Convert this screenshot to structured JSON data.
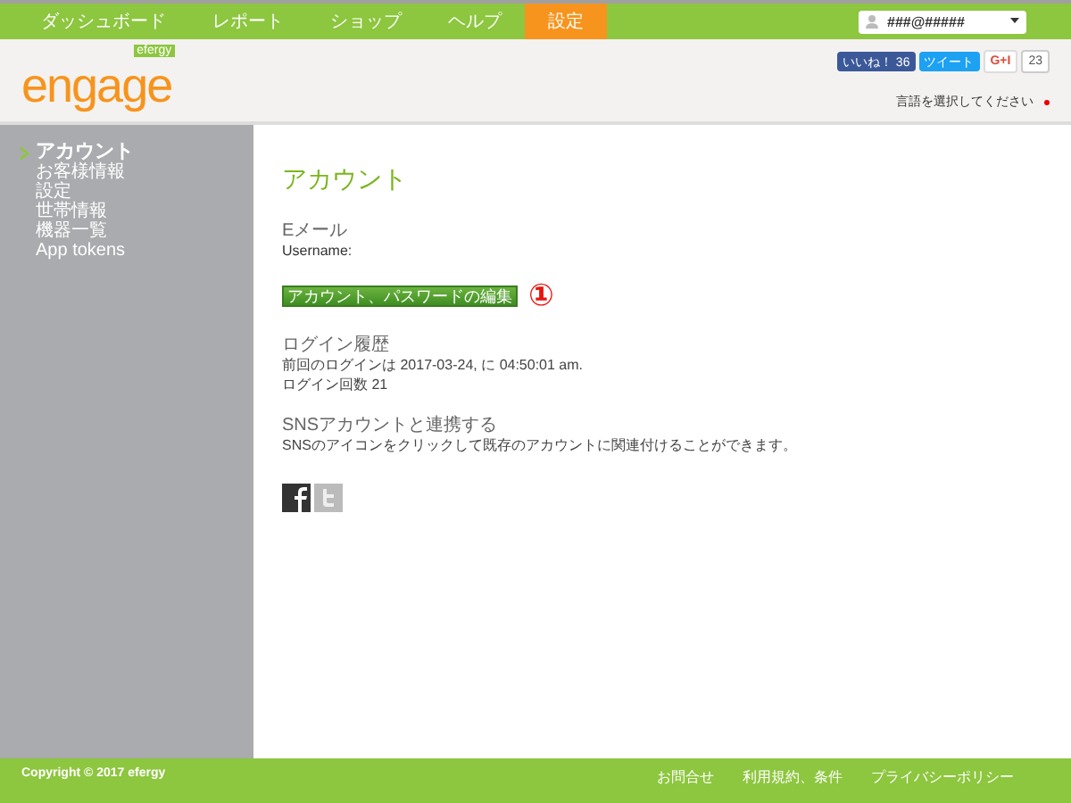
{
  "nav": {
    "tabs": [
      {
        "label": "ダッシュボード",
        "selected": false
      },
      {
        "label": "レポート",
        "selected": false
      },
      {
        "label": "ショップ",
        "selected": false
      },
      {
        "label": "ヘルプ",
        "selected": false
      },
      {
        "label": "設定",
        "selected": true
      }
    ],
    "user": "###@#####"
  },
  "header": {
    "logo": "engage",
    "logo_badge": "efergy",
    "like": {
      "label": "いいね！",
      "count": "36"
    },
    "tweet": "ツイート",
    "gplus": {
      "label": "G+I",
      "count": "23"
    },
    "language": "言語を選択してください"
  },
  "sidebar": {
    "items": [
      {
        "label": "アカウント",
        "selected": true
      },
      {
        "label": "お客様情報",
        "selected": false
      },
      {
        "label": "設定",
        "selected": false
      },
      {
        "label": "世帯情報",
        "selected": false
      },
      {
        "label": "機器一覧",
        "selected": false
      },
      {
        "label": "App tokens",
        "selected": false
      }
    ]
  },
  "content": {
    "title": "アカウント",
    "email_label": "Eメール",
    "username_label": "Username:",
    "edit_button": "アカウント、パスワードの編集",
    "annotation": "①",
    "login": {
      "heading": "ログイン履歴",
      "last": "前回のログインは 2017-03-24, に 04:50:01 am.",
      "count": "ログイン回数 21"
    },
    "sns": {
      "heading": "SNSアカウントと連携する",
      "text": "SNSのアイコンをクリックして既存のアカウントに関連付けることができます。"
    }
  },
  "footer": {
    "copyright": "Copyright © 2017 efergy",
    "links": [
      "お問合せ",
      "利用規約、条件",
      "プライバシーポリシー"
    ]
  }
}
